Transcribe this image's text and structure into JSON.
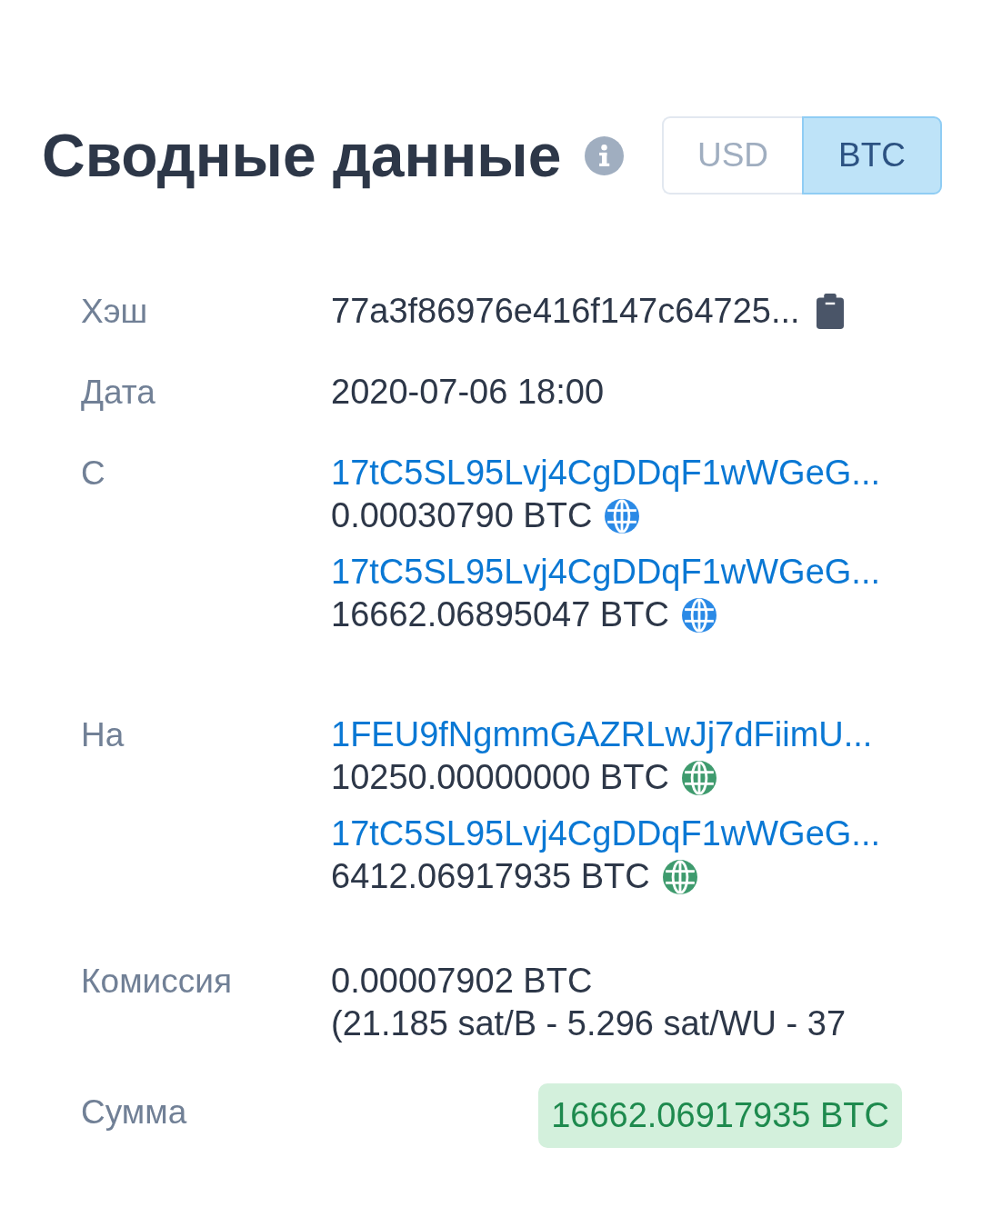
{
  "header": {
    "title": "Сводные данные"
  },
  "currency_toggle": [
    {
      "label": "USD",
      "selected": false
    },
    {
      "label": "BTC",
      "selected": true
    }
  ],
  "rows": [
    {
      "kind": "hash",
      "label": "Хэш",
      "value": "77a3f86976e416f147c64725..."
    },
    {
      "kind": "text",
      "label": "Дата",
      "value": "2020-07-06 18:00"
    },
    {
      "kind": "transfers",
      "label": "С",
      "items": [
        {
          "address": "17tC5SL95Lvj4CgDDqF1wWGeG...",
          "amount": "0.00030790 BTC",
          "color": "#2b8ae6"
        },
        {
          "address": "17tC5SL95Lvj4CgDDqF1wWGeG...",
          "amount": "16662.06895047 BTC",
          "color": "#2b8ae6"
        }
      ]
    },
    {
      "kind": "transfers",
      "label": "На",
      "items": [
        {
          "address": "1FEU9fNgmmGAZRLwJj7dFiimU...",
          "amount": "10250.00000000 BTC",
          "color": "#3f9b6e"
        },
        {
          "address": "17tC5SL95Lvj4CgDDqF1wWGeG...",
          "amount": "6412.06917935 BTC",
          "color": "#3f9b6e"
        }
      ]
    },
    {
      "kind": "fee",
      "label": "Комиссия",
      "amount": "0.00007902 BTC",
      "rate": "(21.185 sat/B - 5.296 sat/WU - 37"
    },
    {
      "kind": "total",
      "label": "Сумма",
      "value": "16662.06917935 BTC"
    }
  ]
}
